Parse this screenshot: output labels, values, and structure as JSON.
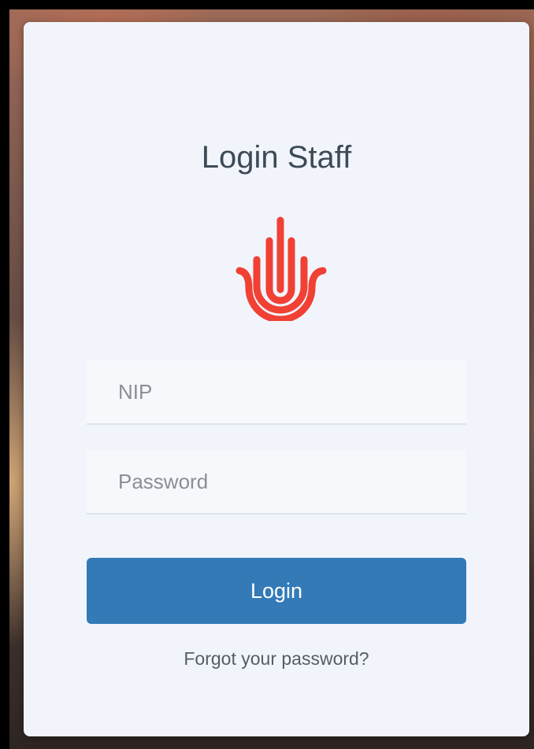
{
  "login_card": {
    "title": "Login Staff",
    "logo_icon": "raised-hand-icon",
    "logo_color": "#f04134",
    "nip_field": {
      "value": "",
      "placeholder": "NIP"
    },
    "password_field": {
      "value": "",
      "placeholder": "Password"
    },
    "login_button_label": "Login",
    "login_button_color": "#337ab7",
    "forgot_password_link": "Forgot your password?"
  }
}
